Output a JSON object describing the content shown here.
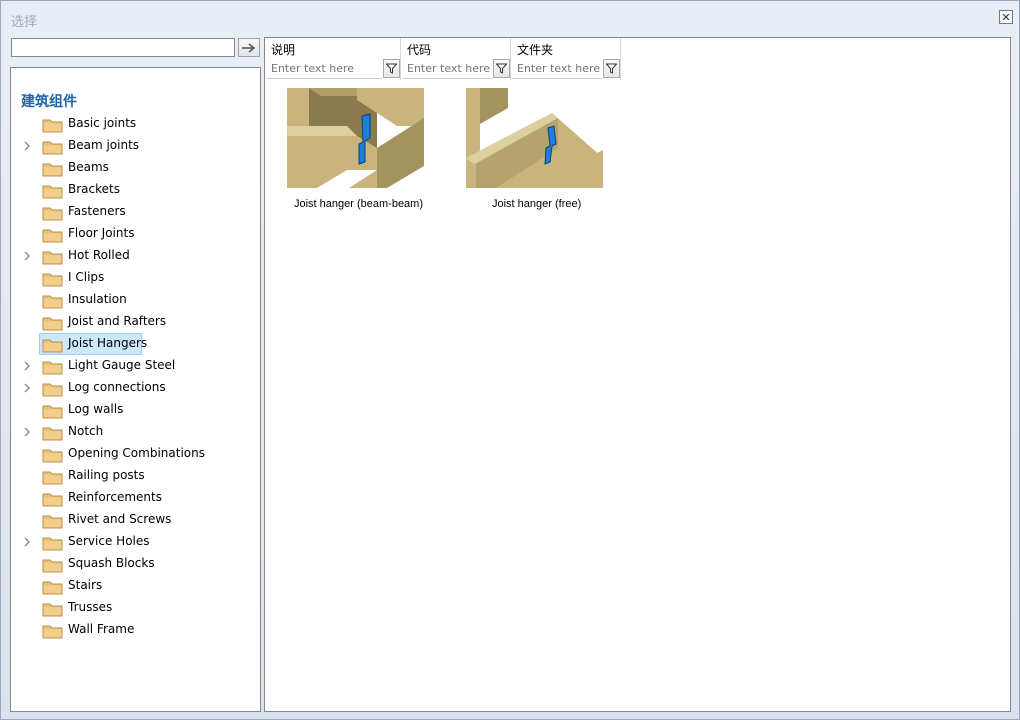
{
  "window": {
    "title": "选择",
    "close_label": "✕"
  },
  "search": {
    "value": "",
    "placeholder": ""
  },
  "tree": {
    "root_label": "建筑组件",
    "items": [
      {
        "label": "Basic joints",
        "expandable": false
      },
      {
        "label": "Beam joints",
        "expandable": true
      },
      {
        "label": "Beams",
        "expandable": false
      },
      {
        "label": "Brackets",
        "expandable": false
      },
      {
        "label": "Fasteners",
        "expandable": false
      },
      {
        "label": "Floor Joints",
        "expandable": false
      },
      {
        "label": "Hot Rolled",
        "expandable": true
      },
      {
        "label": "I Clips",
        "expandable": false
      },
      {
        "label": "Insulation",
        "expandable": false
      },
      {
        "label": "Joist and Rafters",
        "expandable": false
      },
      {
        "label": "Joist Hangers",
        "expandable": false,
        "selected": true
      },
      {
        "label": "Light Gauge Steel",
        "expandable": true
      },
      {
        "label": "Log connections",
        "expandable": true
      },
      {
        "label": "Log walls",
        "expandable": false
      },
      {
        "label": "Notch",
        "expandable": true
      },
      {
        "label": "Opening Combinations",
        "expandable": false
      },
      {
        "label": "Railing posts",
        "expandable": false
      },
      {
        "label": "Reinforcements",
        "expandable": false
      },
      {
        "label": "Rivet and Screws",
        "expandable": false
      },
      {
        "label": "Service Holes",
        "expandable": true
      },
      {
        "label": "Squash Blocks",
        "expandable": false
      },
      {
        "label": "Stairs",
        "expandable": false
      },
      {
        "label": "Trusses",
        "expandable": false
      },
      {
        "label": "Wall Frame",
        "expandable": false
      }
    ]
  },
  "columns": [
    {
      "title": "说明",
      "placeholder": "Enter text here"
    },
    {
      "title": "代码",
      "placeholder": "Enter text here"
    },
    {
      "title": "文件夹",
      "placeholder": "Enter text here"
    }
  ],
  "thumbnails": [
    {
      "caption": "Joist hanger (beam-beam)"
    },
    {
      "caption": "Joist hanger (free)"
    }
  ],
  "colors": {
    "accent": "#1e64ad",
    "selection": "#cce8ff",
    "folder": "#e8c27a",
    "wood": "#c9b47e",
    "hanger": "#1e7fd6"
  }
}
